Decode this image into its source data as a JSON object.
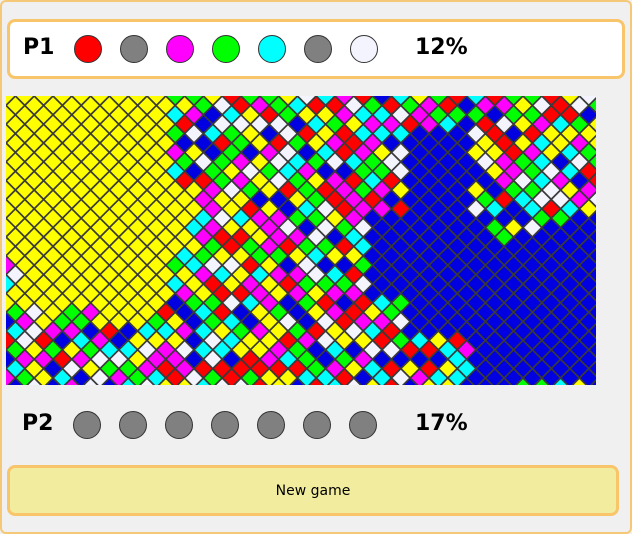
{
  "p1": {
    "label": "P1",
    "percent": "12%",
    "palette": [
      {
        "name": "red",
        "color": "#ff0000"
      },
      {
        "name": "gray",
        "color": "#808080"
      },
      {
        "name": "magenta",
        "color": "#ff00ff"
      },
      {
        "name": "green",
        "color": "#00ff00"
      },
      {
        "name": "cyan",
        "color": "#00ffff"
      },
      {
        "name": "gray",
        "color": "#808080"
      },
      {
        "name": "white",
        "color": "#f4f4ff"
      }
    ]
  },
  "p2": {
    "label": "P2",
    "percent": "17%",
    "palette": [
      {
        "name": "gray",
        "color": "#808080"
      },
      {
        "name": "gray",
        "color": "#808080"
      },
      {
        "name": "gray",
        "color": "#808080"
      },
      {
        "name": "gray",
        "color": "#808080"
      },
      {
        "name": "gray",
        "color": "#808080"
      },
      {
        "name": "gray",
        "color": "#808080"
      },
      {
        "name": "gray",
        "color": "#808080"
      }
    ]
  },
  "board": {
    "colors": [
      "#ffff00",
      "#ff0000",
      "#ff00ff",
      "#00ff00",
      "#00ffff",
      "#0000e0",
      "#f4f4ff"
    ],
    "p1_color": "#ffff00",
    "p2_color": "#0000e0",
    "background": "#3a3a3a"
  },
  "new_game_label": "New game"
}
